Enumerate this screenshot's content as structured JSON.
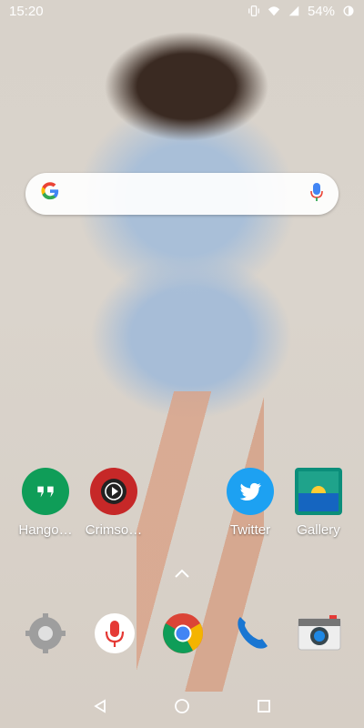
{
  "status_bar": {
    "time": "15:20",
    "battery_percent": "54%",
    "icons": [
      "vibrate-icon",
      "wifi-icon",
      "signal-icon",
      "battery-icon"
    ]
  },
  "search": {
    "logo": "G",
    "icons": [
      "google-logo",
      "mic-icon"
    ]
  },
  "home_apps": [
    {
      "label": "Hango…",
      "icon": "hangouts-icon",
      "color": "#0f9d58"
    },
    {
      "label": "Crimso…",
      "icon": "crimson-player-icon",
      "color": "#c62828"
    },
    {
      "label": "Twitter",
      "icon": "twitter-icon",
      "color": "#1da1f2"
    },
    {
      "label": "Gallery",
      "icon": "gallery-icon",
      "color": "#0b8e7a"
    }
  ],
  "dock": [
    {
      "icon": "settings-icon",
      "color": "#9e9e9e"
    },
    {
      "icon": "voice-recorder-icon",
      "color": "#ffffff"
    },
    {
      "icon": "chrome-icon",
      "color": "#4285f4"
    },
    {
      "icon": "phone-icon",
      "color": "#1976d2"
    },
    {
      "icon": "camera-icon",
      "color": "#e0e0e0"
    }
  ],
  "nav": {
    "icons": [
      "back-icon",
      "home-icon",
      "recents-icon"
    ]
  }
}
